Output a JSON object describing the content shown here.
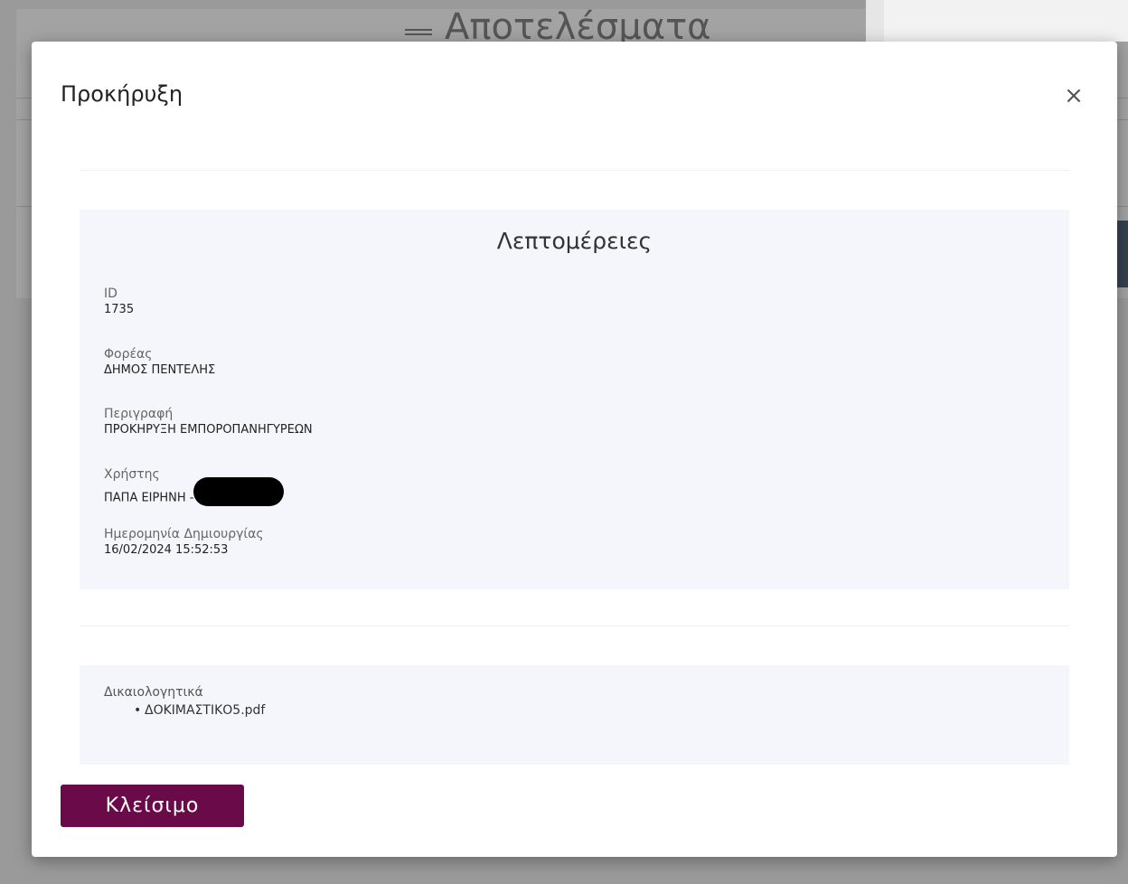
{
  "background": {
    "title": "Αποτελέσματα"
  },
  "modal": {
    "title": "Προκήρυξη",
    "close_icon": "×",
    "details": {
      "heading": "Λεπτομέρειες",
      "fields": [
        {
          "label": "ID",
          "value": "1735"
        },
        {
          "label": "Φορέας",
          "value": "ΔΗΜΟΣ ΠΕΝΤΕΛΗΣ"
        },
        {
          "label": "Περιγραφή",
          "value": "ΠΡΟΚΗΡΥΞΗ ΕΜΠΟΡΟΠΑΝΗΓΥΡΕΩΝ"
        },
        {
          "label": "Χρήστης",
          "value": "ΠΑΠΑ ΕΙΡΗΝΗ -"
        },
        {
          "label": "Ημερομηνία Δημιουργίας",
          "value": "16/02/2024 15:52:53"
        }
      ]
    },
    "documents": {
      "label": "Δικαιολογητικά",
      "items": [
        "ΔΟΚΙΜΑΣΤΙΚΟ5.pdf"
      ]
    },
    "close_button_label": "Κλείσιμο",
    "colors": {
      "primary_button": "#6a0a48",
      "card_background": "#f4f6fb"
    }
  }
}
